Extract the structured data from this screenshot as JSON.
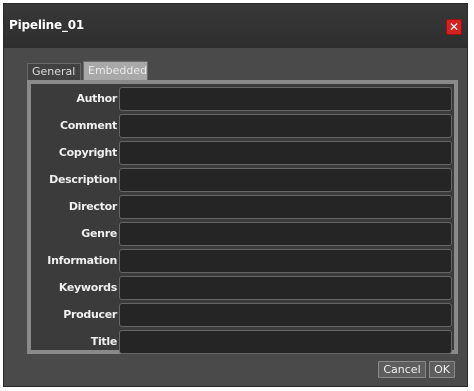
{
  "window": {
    "title": "Pipeline_01",
    "close_glyph": "✕"
  },
  "tabs": [
    {
      "label": "General",
      "active": false
    },
    {
      "label": "Embedded",
      "active": true
    }
  ],
  "fields": [
    {
      "label": "Author",
      "value": ""
    },
    {
      "label": "Comment",
      "value": ""
    },
    {
      "label": "Copyright",
      "value": ""
    },
    {
      "label": "Description",
      "value": ""
    },
    {
      "label": "Director",
      "value": ""
    },
    {
      "label": "Genre",
      "value": ""
    },
    {
      "label": "Information",
      "value": ""
    },
    {
      "label": "Keywords",
      "value": ""
    },
    {
      "label": "Producer",
      "value": ""
    },
    {
      "label": "Title",
      "value": ""
    }
  ],
  "buttons": {
    "cancel": "Cancel",
    "ok": "OK"
  },
  "colors": {
    "close_button": "#d42222",
    "active_tab": "#a8a8a8",
    "panel_border": "#8a8a8a"
  }
}
